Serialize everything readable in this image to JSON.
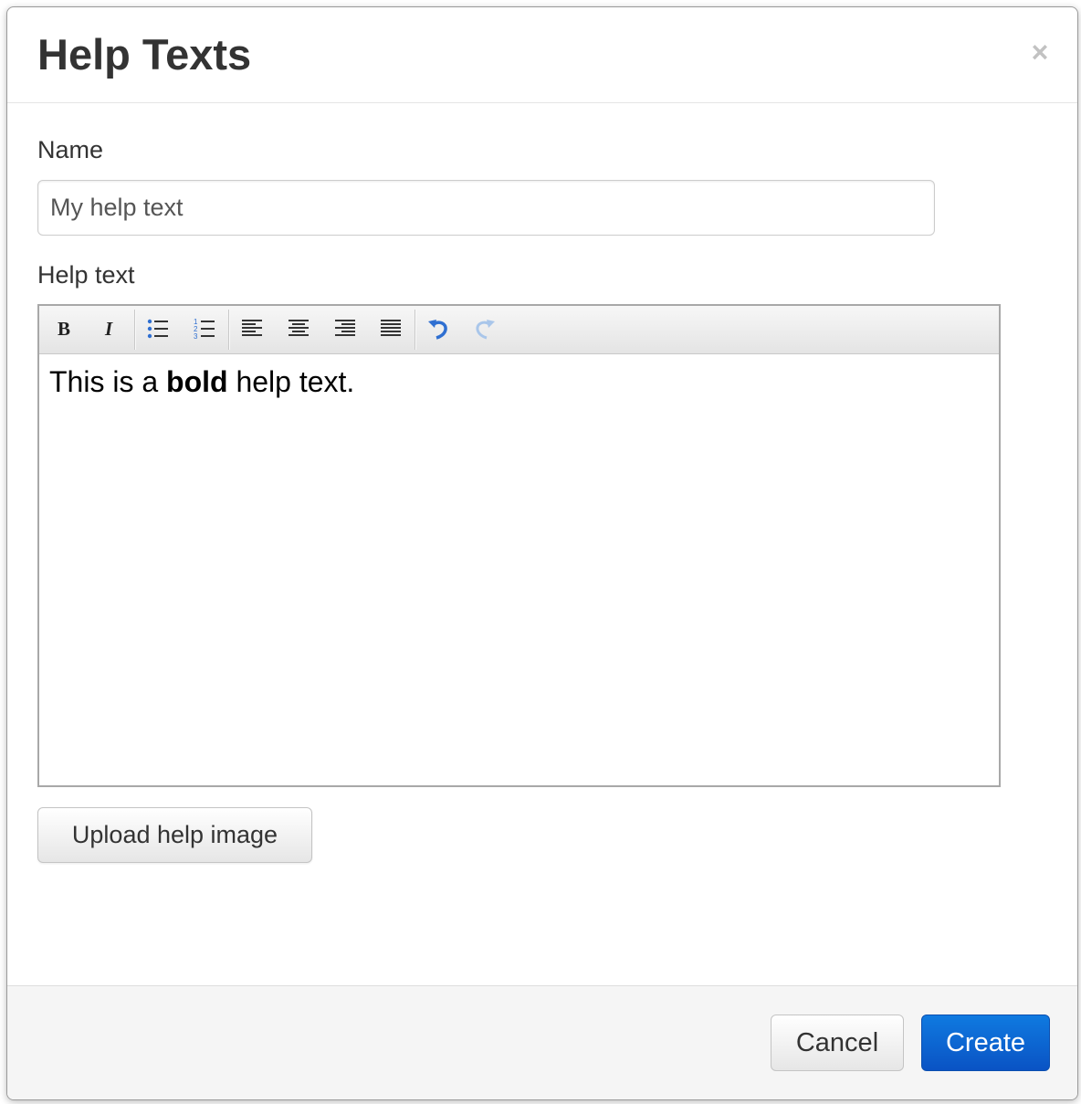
{
  "dialog": {
    "title": "Help Texts",
    "close_symbol": "×"
  },
  "form": {
    "name_label": "Name",
    "name_value": "My help text",
    "help_label": "Help text",
    "editor": {
      "content_before": "This is a ",
      "content_bold": "bold",
      "content_after": " help text.",
      "toolbar_icons": [
        "bold-icon",
        "italic-icon",
        "bullet-list-icon",
        "numbered-list-icon",
        "align-left-icon",
        "align-center-icon",
        "align-right-icon",
        "justify-icon",
        "undo-icon",
        "redo-icon"
      ]
    },
    "upload_label": "Upload help image"
  },
  "footer": {
    "cancel_label": "Cancel",
    "create_label": "Create"
  },
  "colors": {
    "primary": "#0a62d4",
    "undo_icon": "#2f6fd1",
    "redo_icon_disabled": "#a9c6ea"
  }
}
